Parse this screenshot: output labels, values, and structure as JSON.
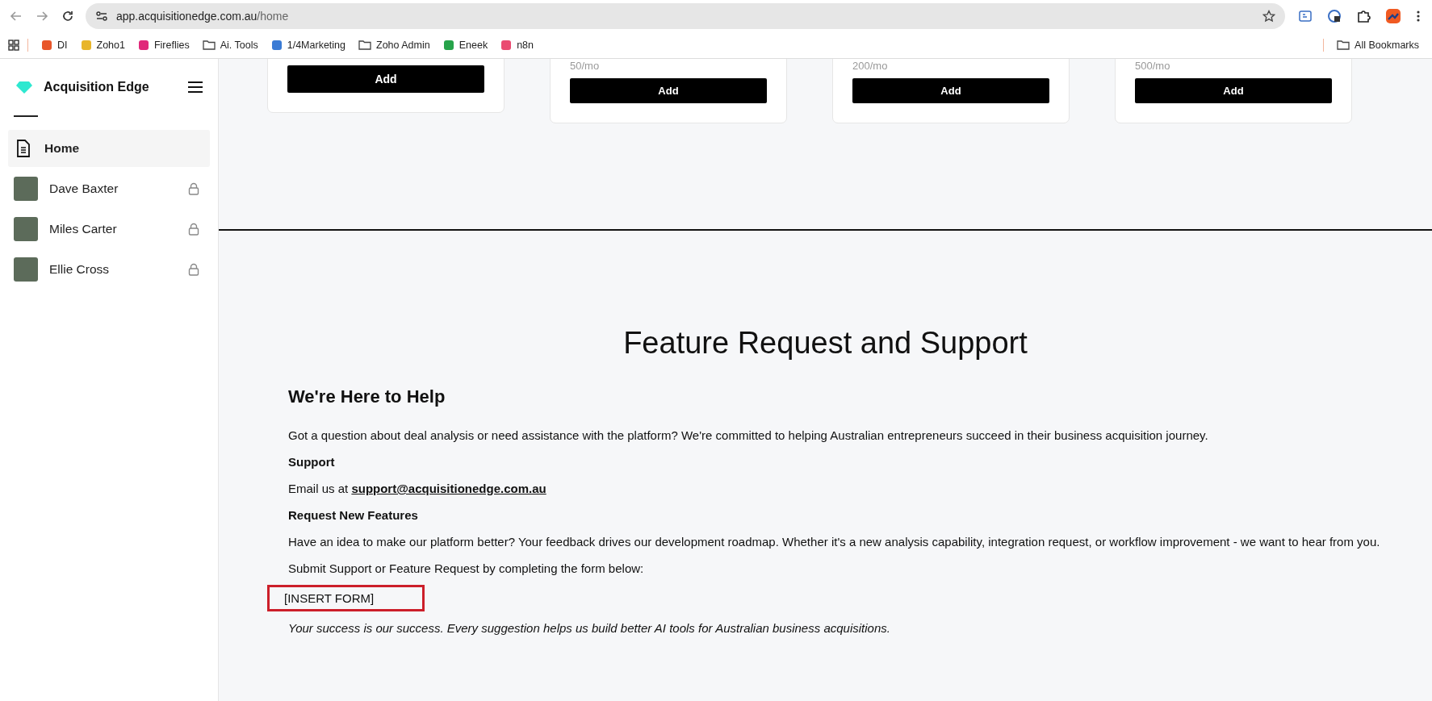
{
  "browser": {
    "url": "app.acquisitionedge.com.au/home",
    "bookmarks": [
      {
        "kind": "site",
        "label": "DI",
        "color": "#e8562a"
      },
      {
        "kind": "site",
        "label": "Zoho1",
        "color": "#e8b52a"
      },
      {
        "kind": "site",
        "label": "Fireflies",
        "color": "#e0287a"
      },
      {
        "kind": "folder",
        "label": "Ai. Tools"
      },
      {
        "kind": "site",
        "label": "1/4Marketing",
        "color": "#3a7bd5"
      },
      {
        "kind": "folder",
        "label": "Zoho Admin"
      },
      {
        "kind": "site",
        "label": "Eneek",
        "color": "#27a34a"
      },
      {
        "kind": "site",
        "label": "n8n",
        "color": "#ea4b71"
      }
    ],
    "all_bookmarks": "All Bookmarks"
  },
  "sidebar": {
    "brand": "Acquisition Edge",
    "items": [
      {
        "kind": "page",
        "label": "Home",
        "selected": true
      },
      {
        "kind": "person",
        "label": "Dave Baxter",
        "selected": false,
        "locked": true
      },
      {
        "kind": "person",
        "label": "Miles Carter",
        "selected": false,
        "locked": true
      },
      {
        "kind": "person",
        "label": "Ellie Cross",
        "selected": false,
        "locked": true
      }
    ]
  },
  "plans": [
    {
      "button": "Add"
    },
    {
      "price": "50/mo",
      "button": "Add"
    },
    {
      "price": "200/mo",
      "button": "Add"
    },
    {
      "price": "500/mo",
      "button": "Add"
    }
  ],
  "support": {
    "title": "Feature Request and Support",
    "blocks": [
      {
        "kind": "heading",
        "text": "We're Here to Help"
      },
      {
        "kind": "text",
        "text": "Got a question about deal analysis or need assistance with the platform? We're committed to helping Australian entrepreneurs succeed in their business acquisition journey."
      },
      {
        "kind": "subheading",
        "text": "Support"
      },
      {
        "kind": "email",
        "text": "Email us at",
        "link": "support@acquisitionedge.com.au"
      },
      {
        "kind": "subheading",
        "text": "Request New Features"
      },
      {
        "kind": "text",
        "text": "Have an idea to make our platform better? Your feedback drives our development roadmap. Whether it's a new analysis capability, integration request, or workflow improvement - we want to hear from you."
      },
      {
        "kind": "text",
        "text": "Submit Support or Feature Request by completing the form below:"
      },
      {
        "kind": "placeholder",
        "text": "[INSERT FORM]"
      },
      {
        "kind": "note",
        "text": "Your success is our success. Every suggestion helps us build better AI tools for Australian business acquisitions."
      }
    ]
  }
}
